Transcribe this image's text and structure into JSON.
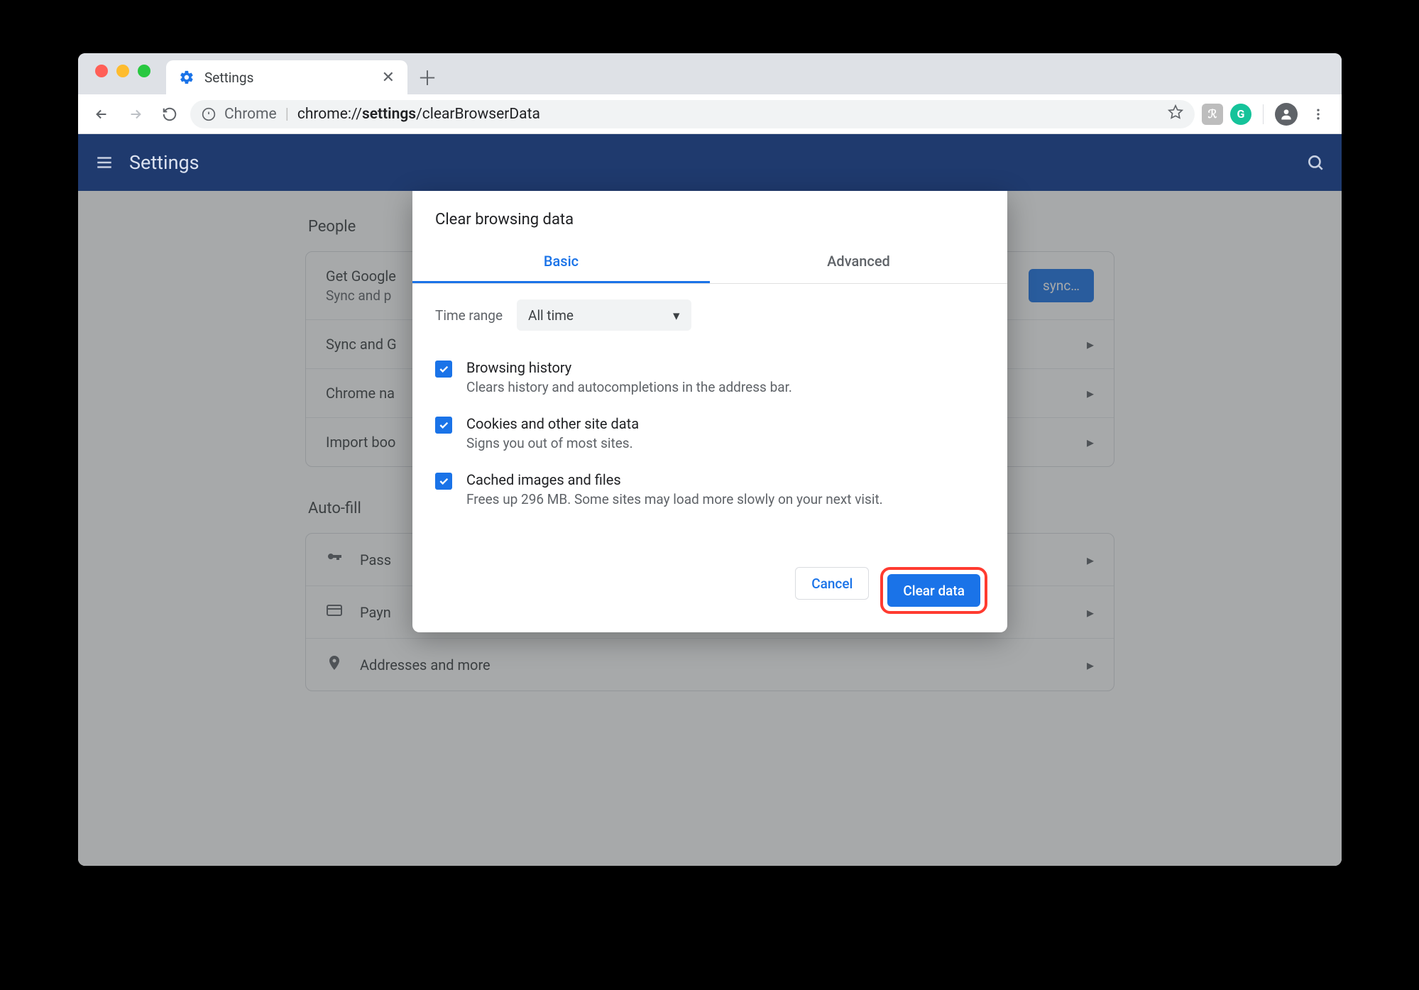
{
  "tab": {
    "title": "Settings"
  },
  "omnibox": {
    "prefix": "Chrome",
    "path_a": "chrome://",
    "path_b": "settings",
    "path_c": "/clearBrowserData"
  },
  "appbar": {
    "title": "Settings"
  },
  "settings": {
    "people_heading": "People",
    "people_rows": {
      "row1_primary": "Get Google",
      "row1_secondary": "Sync and p",
      "row1_btn": "sync…",
      "row2": "Sync and G",
      "row3": "Chrome na",
      "row4": "Import boo"
    },
    "autofill_heading": "Auto-fill",
    "autofill_rows": {
      "passwords": "Pass",
      "payments": "Payn",
      "addresses": "Addresses and more"
    }
  },
  "dialog": {
    "title": "Clear browsing data",
    "tabs": {
      "basic": "Basic",
      "advanced": "Advanced"
    },
    "time_label": "Time range",
    "time_value": "All time",
    "items": [
      {
        "title": "Browsing history",
        "desc": "Clears history and autocompletions in the address bar."
      },
      {
        "title": "Cookies and other site data",
        "desc": "Signs you out of most sites."
      },
      {
        "title": "Cached images and files",
        "desc": "Frees up 296 MB. Some sites may load more slowly on your next visit."
      }
    ],
    "cancel": "Cancel",
    "confirm": "Clear data"
  }
}
